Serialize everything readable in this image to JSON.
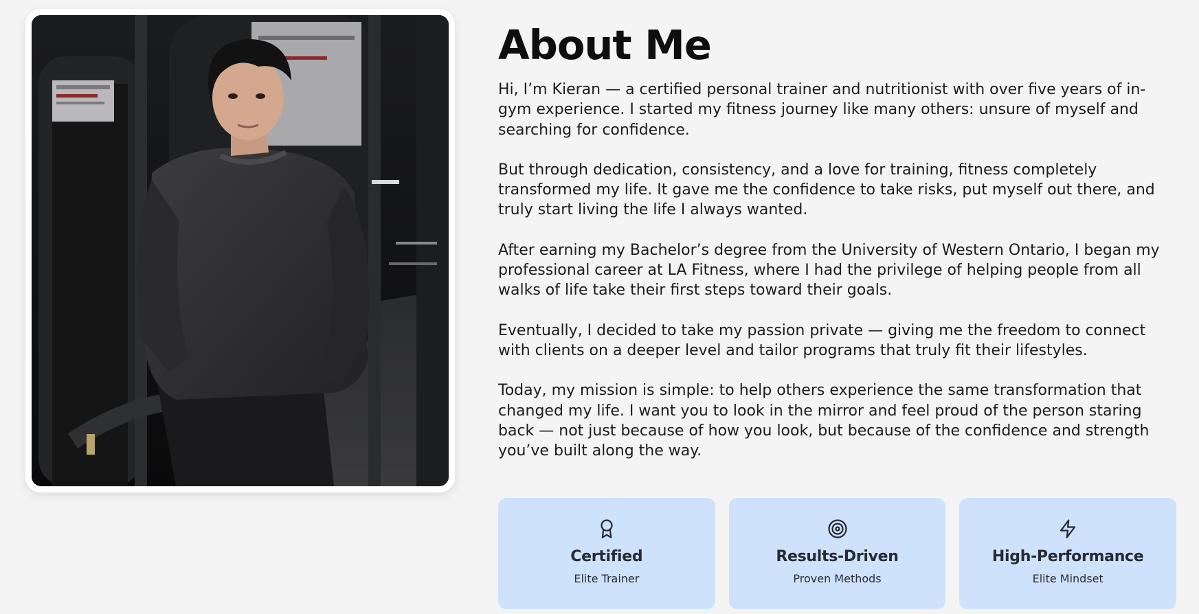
{
  "about": {
    "title": "About Me",
    "paragraphs": [
      "Hi, I’m Kieran — a certified personal trainer and nutritionist with over five years of in-gym experience. I started my fitness journey like many others: unsure of myself and searching for confidence.",
      "But through dedication, consistency, and a love for training, fitness completely transformed my life. It gave me the confidence to take risks, put myself out there, and truly start living the life I always wanted.",
      "After earning my Bachelor’s degree from the University of Western Ontario, I began my professional career at LA Fitness, where I had the privilege of helping people from all walks of life take their first steps toward their goals.",
      "Eventually, I decided to take my passion private — giving me the freedom to connect with clients on a deeper level and tailor programs that truly fit their lifestyles.",
      "Today, my mission is simple: to help others experience the same transformation that changed my life. I want you to look in the mirror and feel proud of the person staring back — not just because of how you look, but because of the confidence and strength you’ve built along the way."
    ]
  },
  "photo": {
    "alt": "Trainer portrait in gym"
  },
  "features": [
    {
      "icon": "award-icon",
      "title": "Certified",
      "subtitle": "Elite Trainer"
    },
    {
      "icon": "target-icon",
      "title": "Results-Driven",
      "subtitle": "Proven Methods"
    },
    {
      "icon": "lightning-icon",
      "title": "High-Performance",
      "subtitle": "Elite Mindset"
    }
  ],
  "colors": {
    "background": "#f4f4f4",
    "card": "#cfe2fb",
    "text": "#1a1a1a"
  }
}
